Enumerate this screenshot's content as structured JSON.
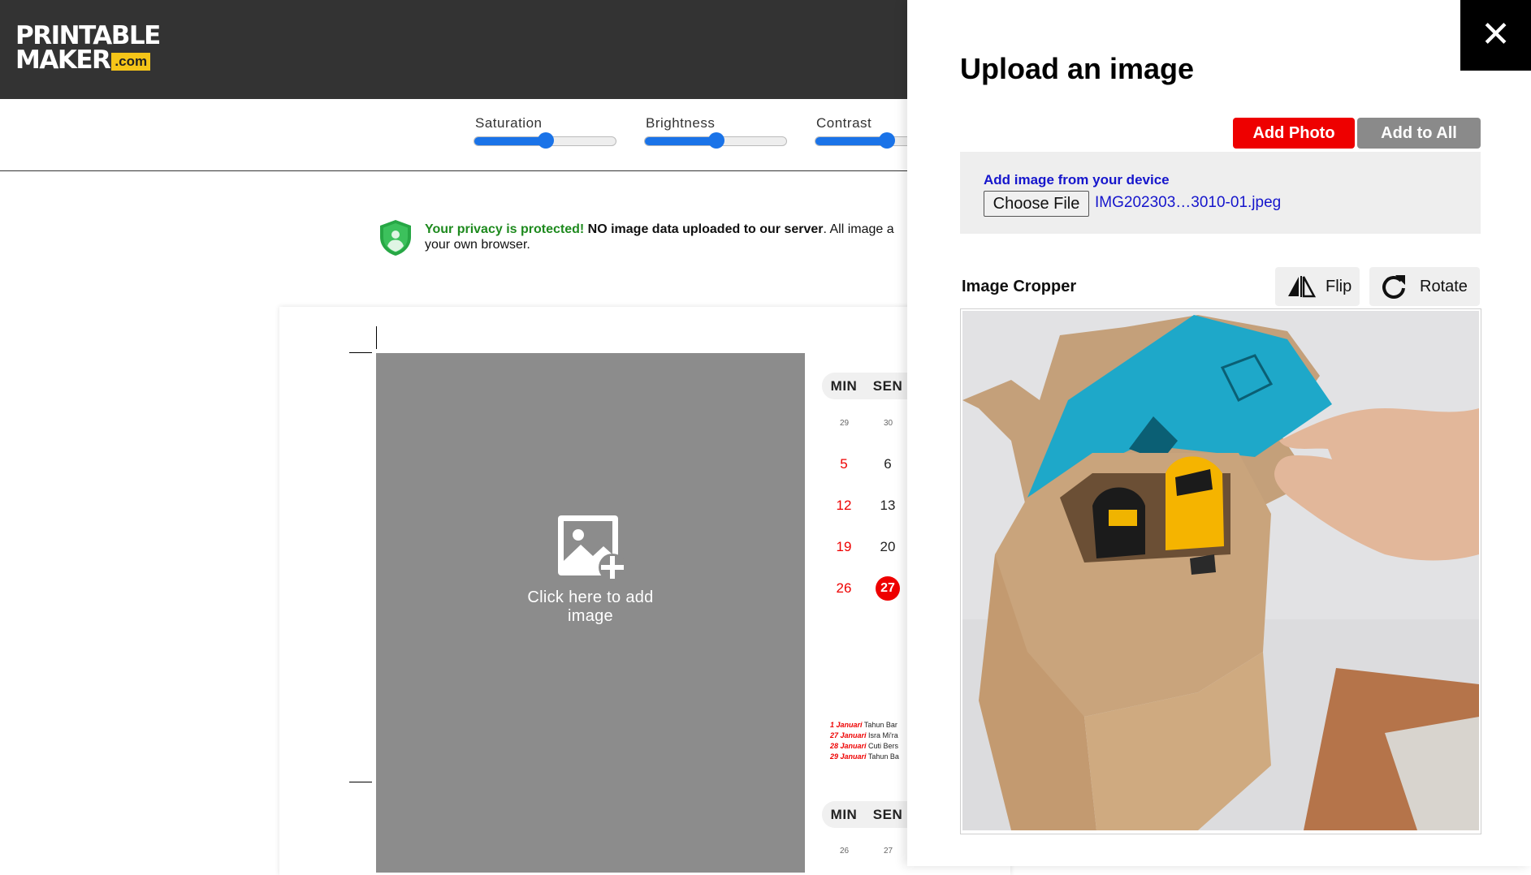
{
  "header": {
    "logo_line1": "PRINTABLE",
    "logo_line2": "MAKER",
    "logo_suffix": ".com"
  },
  "sliders": [
    {
      "label": "Saturation",
      "value_fraction": 0.5
    },
    {
      "label": "Brightness",
      "value_fraction": 0.5
    },
    {
      "label": "Contrast",
      "value_fraction": 0.5
    }
  ],
  "privacy": {
    "highlight": "Your privacy is protected!",
    "bold": "NO image data uploaded to our server",
    "rest": ". All image a",
    "line2": "your own browser."
  },
  "placeholder": {
    "line1": "Click here to add",
    "line2": "image"
  },
  "calendar": {
    "headers": [
      "MIN",
      "SEN"
    ],
    "prev_days": [
      "29",
      "30"
    ],
    "rows": [
      [
        "5",
        "6"
      ],
      [
        "12",
        "13"
      ],
      [
        "19",
        "20"
      ],
      [
        "26",
        "27"
      ]
    ],
    "today": "27",
    "second_headers": [
      "MIN",
      "SEN"
    ],
    "second_prev_days": [
      "26",
      "27"
    ],
    "holidays": [
      {
        "date": "1 Januari",
        "name": "Tahun Bar"
      },
      {
        "date": "27 Januari",
        "name": "Isra Mi'ra"
      },
      {
        "date": "28 Januari",
        "name": "Cuti Bers"
      },
      {
        "date": "29 Januari",
        "name": "Tahun Ba"
      }
    ]
  },
  "panel": {
    "close": "✕",
    "title": "Upload an image",
    "add_photo": "Add Photo",
    "add_to_all": "Add to All",
    "device_label": "Add image from your device",
    "choose_file": "Choose File",
    "file_name": "IMG202303…3010-01.jpeg",
    "cropper_label": "Image Cropper",
    "flip": "Flip",
    "rotate": "Rotate"
  },
  "colors": {
    "header_bg": "#333333",
    "accent_blue": "#1a73e8",
    "add_photo_red": "#ee0000",
    "add_all_grey": "#8a8a8a",
    "link_blue": "#1515cc",
    "privacy_green": "#1e8a1e",
    "logo_yellow": "#f5c518"
  },
  "icons": {
    "shield": "shield-user-icon",
    "add_image": "add-image-icon",
    "close": "close-icon",
    "flip": "flip-icon",
    "rotate": "rotate-icon"
  }
}
